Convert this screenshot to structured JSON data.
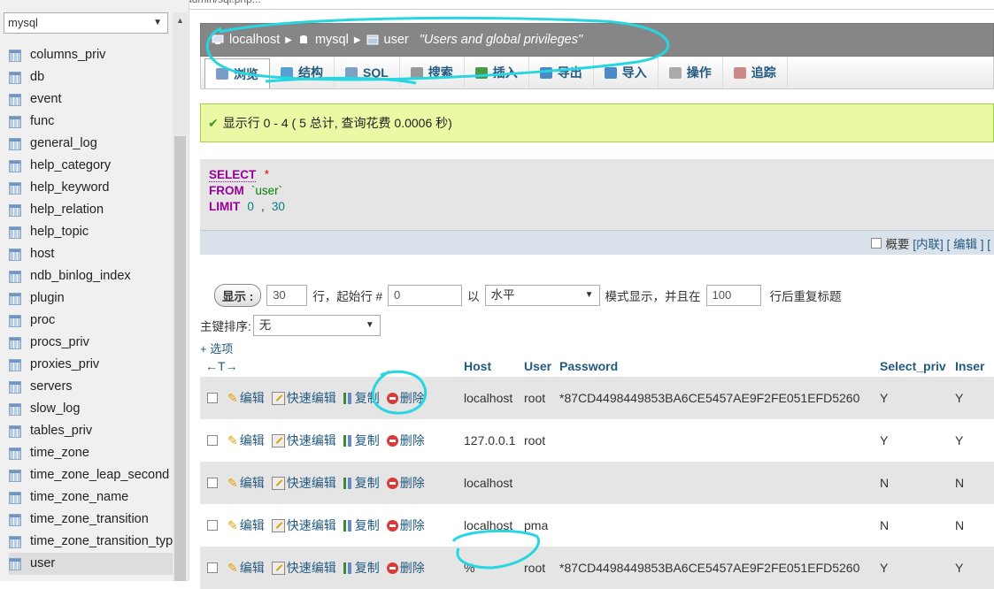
{
  "left_panel": {
    "db_selected": "mysql",
    "tables": [
      "columns_priv",
      "db",
      "event",
      "func",
      "general_log",
      "help_category",
      "help_keyword",
      "help_relation",
      "help_topic",
      "host",
      "ndb_binlog_index",
      "plugin",
      "proc",
      "procs_priv",
      "proxies_priv",
      "servers",
      "slow_log",
      "tables_priv",
      "time_zone",
      "time_zone_leap_second",
      "time_zone_name",
      "time_zone_transition",
      "time_zone_transition_type",
      "user"
    ],
    "active_table": "user"
  },
  "breadcrumb": {
    "server": "localhost",
    "database": "mysql",
    "table": "user",
    "comment": "\"Users and global privileges\""
  },
  "tabs": [
    "浏览",
    "结构",
    "SQL",
    "搜索",
    "插入",
    "导出",
    "导入",
    "操作",
    "追踪"
  ],
  "success_message": "显示行 0 - 4 ( 5 总计, 查询花费 0.0006 秒)",
  "sql": {
    "select": "SELECT",
    "star": "*",
    "from": "FROM",
    "table": "`user`",
    "limit": "LIMIT",
    "offset": "0",
    "comma": ",",
    "count": "30"
  },
  "profiling": {
    "checkbox_label": "概要",
    "links": [
      "[内联]",
      "[ 编辑 ] ["
    ]
  },
  "nav": {
    "show_button": "显示 :",
    "rows": "30",
    "rows_label": "行，起始行 #",
    "start": "0",
    "mode_label": "以",
    "mode": "水平",
    "mode_suffix": "模式显示，并且在",
    "repeat": "100",
    "repeat_suffix": "行后重复标题"
  },
  "sort": {
    "label": "主键排序:",
    "value": "无"
  },
  "options_link": "+ 选项",
  "table": {
    "arrows": "←T→",
    "columns": [
      "Host",
      "User",
      "Password",
      "Select_priv",
      "Inser"
    ],
    "actions": {
      "edit": "编辑",
      "quick_edit": "快速编辑",
      "copy": "复制",
      "delete": "删除"
    },
    "rows": [
      {
        "host": "localhost",
        "user": "root",
        "password": "*87CD4498449853BA6CE5457AE9F2FE051EFD5260",
        "select_priv": "Y",
        "insert_priv": "Y"
      },
      {
        "host": "127.0.0.1",
        "user": "root",
        "password": "",
        "select_priv": "Y",
        "insert_priv": "Y"
      },
      {
        "host": "localhost",
        "user": "",
        "password": "",
        "select_priv": "N",
        "insert_priv": "N"
      },
      {
        "host": "localhost",
        "user": "pma",
        "password": "",
        "select_priv": "N",
        "insert_priv": "N"
      },
      {
        "host": "%",
        "user": "root",
        "password": "*87CD4498449853BA6CE5457AE9F2FE051EFD5260",
        "select_priv": "Y",
        "insert_priv": "Y"
      }
    ]
  },
  "colors": {
    "link": "#235a81",
    "success_bg": "#ebf8a4",
    "breadcrumb_bg": "#868686",
    "annotation": "#27d6e0"
  }
}
